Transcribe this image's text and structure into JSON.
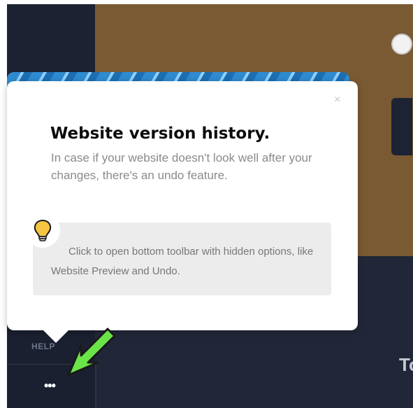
{
  "popup": {
    "title": "Website version history.",
    "description": "In case if your website doesn't look well after your changes, there's an undo feature.",
    "close_label": "×",
    "tip": "Click to open bottom toolbar with hidden options, like Website Preview and Undo."
  },
  "sidebar": {
    "help_label": "HELP",
    "more_label": "•••"
  },
  "main": {
    "partial_heading": "To"
  },
  "colors": {
    "hero": "#7a5a33",
    "dark_bg": "#1f2536",
    "arrow": "#6be44a",
    "stripe": "#2f8bd0"
  }
}
